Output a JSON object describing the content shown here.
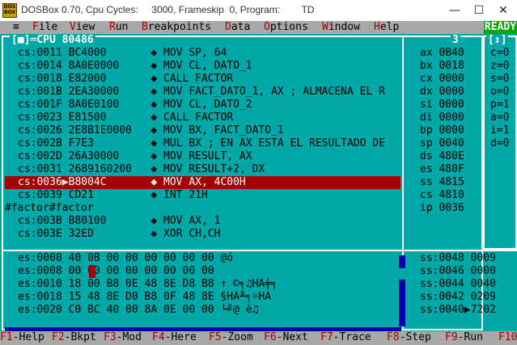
{
  "window": {
    "icon_label": "DOS BOX",
    "title": "DOSBox 0.70, Cpu Cycles:     3000, Frameskip  0, Program:        TD",
    "min": "—",
    "max": "☐",
    "close": "✕"
  },
  "menu": {
    "sys": "≡",
    "items": [
      {
        "hot": "F",
        "rest": "ile"
      },
      {
        "hot": "V",
        "rest": "iew"
      },
      {
        "hot": "R",
        "rest": "un"
      },
      {
        "hot": "B",
        "rest": "reakpoints"
      },
      {
        "hot": "D",
        "rest": "ata"
      },
      {
        "hot": "O",
        "rest": "ptions"
      },
      {
        "hot": "W",
        "rest": "indow"
      },
      {
        "hot": "H",
        "rest": "elp"
      }
    ],
    "ready": "READY"
  },
  "cpu_pane": {
    "title": "[■]═CPU 80486",
    "number_right": "3",
    "reg_num": "1",
    "rows": [
      "cs:0011 BC4000       ◆ MOV SP, 64",
      "cs:0014 8A0E0000     ◆ MOV CL, DATO_1",
      "cs:0018 E82000       ◆ CALL FACTOR",
      "cs:001B 2EA30000     ◆ MOV FACT_DATO_1, AX ; ALMACENA EL R",
      "cs:001F 8A0E0100     ◆ MOV CL, DATO_2",
      "cs:0023 E81500       ◆ CALL FACTOR",
      "cs:0026 2E8B1E0000   ◆ MOV BX, FACT_DATO_1",
      "cs:002B F7E3         ◆ MUL BX ; EN AX ESTA EL RESULTADO DE",
      "cs:002D 26A30000     ◆ MOV RESULT, AX",
      "cs:0031 2689160200   ◆ MOV RESULT+2, DX",
      "cs:0036▶B8004C       ◆ MOV AX, 4C00H",
      "cs:0039 CD21         ◆ INT 21H",
      "#factor#factor",
      "cs:003B B80100       ◆ MOV AX, 1",
      "cs:003E 32ED         ◆ XOR CH,CH"
    ],
    "highlight_index": 10
  },
  "registers": [
    "ax 0B40",
    "bx 0018",
    "cx 0000",
    "dx 0000",
    "si 0000",
    "di 0000",
    "bp 0000",
    "sp 0040",
    "ds 480E",
    "es 480F",
    "ss 4815",
    "cs 4810",
    "ip 0036"
  ],
  "flags": [
    "c=0",
    "z=0",
    "s=0",
    "o=0",
    "p=1",
    "a=0",
    "i=1",
    "d=0"
  ],
  "dump": [
    "es:0000 40 0B 00 00 00 00 00 00 @ó",
    "es:0008 00 00 00 00 00 00 00 00",
    "es:0010 18 00 B8 0E 48 8E D8 B8 ↑ ©╕♫HÄ╪╕",
    "es:0018 15 48 8E D0 B8 0F 48 8E §HÄ╨╕☼HÄ",
    "es:0020 C0 BC 40 00 8A 0E 00 00 └╝@ è♫"
  ],
  "stack": [
    "ss:0048 0009",
    "ss:0046 0000",
    "ss:0044 0040",
    "ss:0042 0209",
    "ss:0040▶7202"
  ],
  "fkeys": [
    {
      "k": "F1",
      "l": "-Help"
    },
    {
      "k": "F2",
      "l": "-Bkpt"
    },
    {
      "k": "F3",
      "l": "-Mod"
    },
    {
      "k": "F4",
      "l": "-Here"
    },
    {
      "k": "F5",
      "l": "-Zoom"
    },
    {
      "k": "F6",
      "l": "-Next"
    },
    {
      "k": "F7",
      "l": "-Trace"
    },
    {
      "k": "F8",
      "l": "-Step"
    },
    {
      "k": "F9",
      "l": "-Run"
    },
    {
      "k": "F10",
      "l": "-Menu"
    }
  ]
}
